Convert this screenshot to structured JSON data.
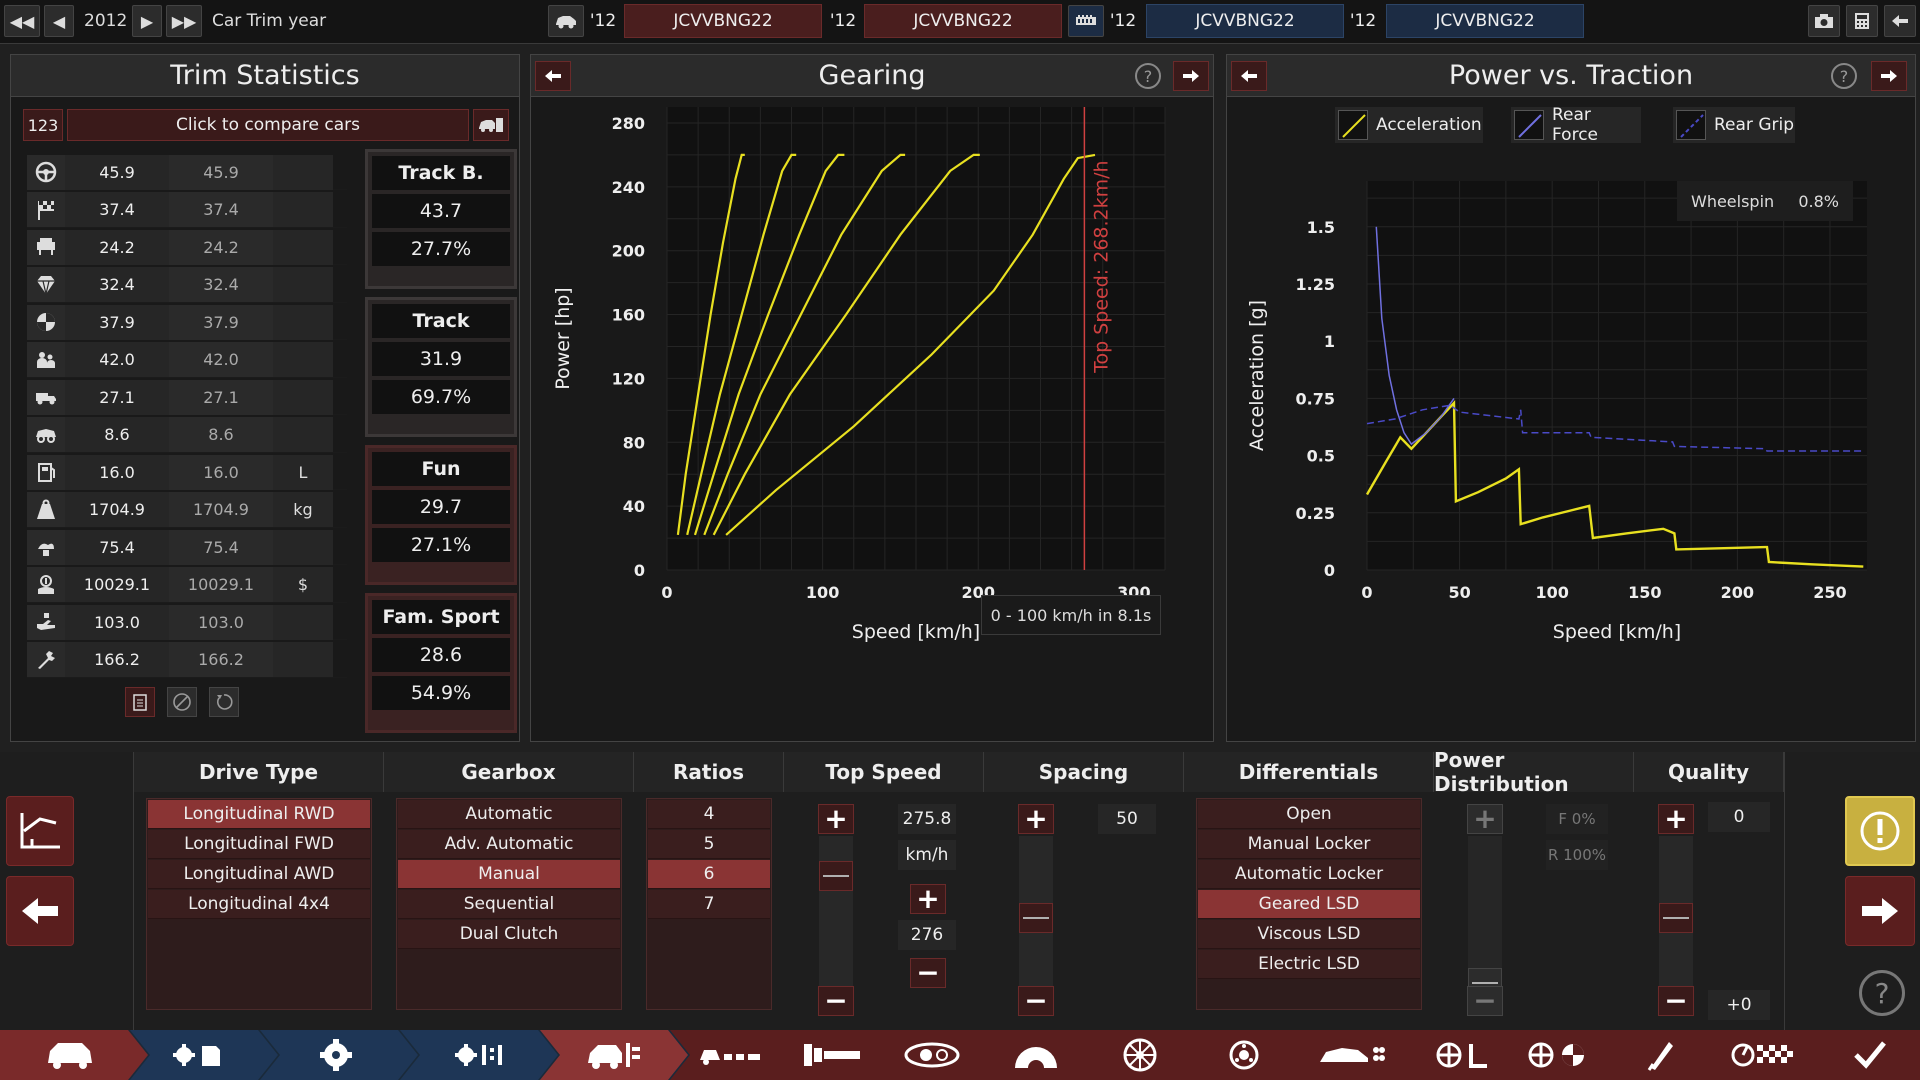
{
  "topbar": {
    "year": "2012",
    "title": "Car Trim year",
    "slots": [
      {
        "year": "'12",
        "name": "JCVVBNG22"
      },
      {
        "year": "'12",
        "name": "JCVVBNG22"
      },
      {
        "year": "'12",
        "name": "JCVVBNG22"
      },
      {
        "year": "'12",
        "name": "JCVVBNG22"
      }
    ]
  },
  "trim_stats": {
    "title": "Trim Statistics",
    "compare_count": "123",
    "compare_label": "Click to compare cars",
    "rows": [
      {
        "icon": "steering-wheel-icon",
        "value": "45.9",
        "compare": "45.9",
        "unit": ""
      },
      {
        "icon": "checkered-flag-icon",
        "value": "37.4",
        "compare": "37.4",
        "unit": ""
      },
      {
        "icon": "seat-icon",
        "value": "24.2",
        "compare": "24.2",
        "unit": ""
      },
      {
        "icon": "gem-icon",
        "value": "32.4",
        "compare": "32.4",
        "unit": ""
      },
      {
        "icon": "safety-icon",
        "value": "37.9",
        "compare": "37.9",
        "unit": ""
      },
      {
        "icon": "passengers-icon",
        "value": "42.0",
        "compare": "42.0",
        "unit": ""
      },
      {
        "icon": "utility-car-icon",
        "value": "27.1",
        "compare": "27.1",
        "unit": ""
      },
      {
        "icon": "offroad-car-icon",
        "value": "8.6",
        "compare": "8.6",
        "unit": ""
      },
      {
        "icon": "fuel-icon",
        "value": "16.0",
        "compare": "16.0",
        "unit": "L"
      },
      {
        "icon": "weight-icon",
        "value": "1704.9",
        "compare": "1704.9",
        "unit": "kg"
      },
      {
        "icon": "emissions-icon",
        "value": "75.4",
        "compare": "75.4",
        "unit": ""
      },
      {
        "icon": "cost-icon",
        "value": "10029.1",
        "compare": "10029.1",
        "unit": "$"
      },
      {
        "icon": "hands-icon",
        "value": "103.0",
        "compare": "103.0",
        "unit": ""
      },
      {
        "icon": "service-icon",
        "value": "166.2",
        "compare": "166.2",
        "unit": ""
      }
    ],
    "categories": [
      {
        "name": "Track B.",
        "score": "43.7",
        "pct": "27.7%"
      },
      {
        "name": "Track",
        "score": "31.9",
        "pct": "69.7%"
      },
      {
        "name": "Fun",
        "score": "29.7",
        "pct": "27.1%"
      },
      {
        "name": "Fam. Sport",
        "score": "28.6",
        "pct": "54.9%"
      }
    ]
  },
  "gearing": {
    "title": "Gearing",
    "acceleration_note": "0 - 100 km/h in 8.1s",
    "top_speed_label": "Top Speed: 268.2km/h"
  },
  "traction": {
    "title": "Power vs. Traction",
    "legend": [
      "Acceleration",
      "Rear Force",
      "Rear Grip"
    ],
    "wheelspin_label": "Wheelspin",
    "wheelspin_value": "0.8%"
  },
  "chart_data": [
    {
      "type": "line",
      "title": "Gearing",
      "xlabel": "Speed [km/h]",
      "ylabel": "Power [hp]",
      "xlim": [
        0,
        320
      ],
      "ylim": [
        0,
        290
      ],
      "xticks": [
        0,
        100,
        200,
        300
      ],
      "yticks": [
        0,
        40,
        80,
        120,
        160,
        200,
        240,
        280
      ],
      "grid": true,
      "top_speed": 268.2,
      "colors": {
        "gears": "#e8e020",
        "top_speed": "#d04040"
      },
      "series": [
        {
          "points": [
            [
              7,
              22
            ],
            [
              12,
              60
            ],
            [
              20,
              110
            ],
            [
              28,
              160
            ],
            [
              36,
              205
            ],
            [
              44,
              245
            ],
            [
              48,
              260
            ],
            [
              50,
              260
            ]
          ]
        },
        {
          "points": [
            [
              13,
              22
            ],
            [
              22,
              60
            ],
            [
              34,
              110
            ],
            [
              48,
              160
            ],
            [
              62,
              210
            ],
            [
              74,
              250
            ],
            [
              80,
              260
            ],
            [
              83,
              260
            ]
          ]
        },
        {
          "points": [
            [
              18,
              22
            ],
            [
              30,
              60
            ],
            [
              46,
              110
            ],
            [
              65,
              160
            ],
            [
              85,
              210
            ],
            [
              102,
              250
            ],
            [
              110,
              260
            ],
            [
              114,
              260
            ]
          ]
        },
        {
          "points": [
            [
              24,
              22
            ],
            [
              39,
              60
            ],
            [
              60,
              110
            ],
            [
              86,
              160
            ],
            [
              112,
              210
            ],
            [
              138,
              250
            ],
            [
              150,
              260
            ],
            [
              153,
              260
            ]
          ]
        },
        {
          "points": [
            [
              30,
              22
            ],
            [
              50,
              60
            ],
            [
              79,
              110
            ],
            [
              115,
              160
            ],
            [
              150,
              210
            ],
            [
              182,
              250
            ],
            [
              197,
              260
            ],
            [
              201,
              260
            ]
          ]
        },
        {
          "points": [
            [
              38,
              22
            ],
            [
              70,
              50
            ],
            [
              120,
              90
            ],
            [
              170,
              135
            ],
            [
              210,
              175
            ],
            [
              235,
              210
            ],
            [
              255,
              245
            ],
            [
              264,
              258
            ],
            [
              275,
              260
            ]
          ]
        }
      ]
    },
    {
      "type": "line",
      "title": "Power vs. Traction",
      "xlabel": "Speed [km/h]",
      "ylabel": "Acceleration [g]",
      "xlim": [
        0,
        270
      ],
      "ylim": [
        0,
        1.7
      ],
      "xticks": [
        0,
        50,
        100,
        150,
        200,
        250
      ],
      "yticks": [
        0,
        0.25,
        0.5,
        0.75,
        1,
        1.25,
        1.5
      ],
      "ytick_labels": [
        "0",
        "0.25",
        "0.5",
        "0.75",
        "1",
        "1.25",
        "1.5"
      ],
      "grid": true,
      "legend_position": "top",
      "series": [
        {
          "name": "Acceleration",
          "color": "#e8e020",
          "dash": false,
          "points": [
            [
              0,
              0.33
            ],
            [
              10,
              0.47
            ],
            [
              18,
              0.58
            ],
            [
              24,
              0.53
            ],
            [
              32,
              0.6
            ],
            [
              40,
              0.67
            ],
            [
              47,
              0.73
            ],
            [
              48,
              0.3
            ],
            [
              60,
              0.34
            ],
            [
              75,
              0.4
            ],
            [
              82,
              0.44
            ],
            [
              83,
              0.2
            ],
            [
              95,
              0.23
            ],
            [
              110,
              0.26
            ],
            [
              120,
              0.28
            ],
            [
              122,
              0.14
            ],
            [
              140,
              0.16
            ],
            [
              160,
              0.18
            ],
            [
              166,
              0.16
            ],
            [
              167,
              0.09
            ],
            [
              190,
              0.095
            ],
            [
              215,
              0.1
            ],
            [
              216,
              0.1
            ],
            [
              217,
              0.035
            ],
            [
              240,
              0.025
            ],
            [
              268,
              0.015
            ]
          ]
        },
        {
          "name": "Rear Force",
          "color": "#7070e0",
          "dash": false,
          "points": [
            [
              5,
              1.5
            ],
            [
              8,
              1.1
            ],
            [
              12,
              0.85
            ],
            [
              16,
              0.7
            ],
            [
              20,
              0.6
            ],
            [
              24,
              0.55
            ],
            [
              32,
              0.6
            ],
            [
              40,
              0.67
            ],
            [
              47,
              0.75
            ]
          ]
        },
        {
          "name": "Rear Grip",
          "color": "#4a4ac8",
          "dash": true,
          "points": [
            [
              0,
              0.64
            ],
            [
              15,
              0.66
            ],
            [
              30,
              0.7
            ],
            [
              45,
              0.72
            ],
            [
              50,
              0.69
            ],
            [
              82,
              0.66
            ],
            [
              83,
              0.7
            ],
            [
              84,
              0.6
            ],
            [
              110,
              0.6
            ],
            [
              120,
              0.6
            ],
            [
              121,
              0.58
            ],
            [
              165,
              0.56
            ],
            [
              166,
              0.54
            ],
            [
              215,
              0.53
            ],
            [
              216,
              0.52
            ],
            [
              268,
              0.52
            ]
          ]
        }
      ]
    }
  ],
  "bottom": {
    "drive_type": {
      "title": "Drive Type",
      "options": [
        "Longitudinal RWD",
        "Longitudinal FWD",
        "Longitudinal AWD",
        "Longitudinal 4x4"
      ],
      "selected": 0
    },
    "gearbox": {
      "title": "Gearbox",
      "options": [
        "Automatic",
        "Adv. Automatic",
        "Manual",
        "Sequential",
        "Dual Clutch"
      ],
      "selected": 2
    },
    "ratios": {
      "title": "Ratios",
      "options": [
        "4",
        "5",
        "6",
        "7"
      ],
      "selected": 2
    },
    "top_speed": {
      "title": "Top Speed",
      "value": "275.8",
      "unit": "km/h",
      "target": "276",
      "slider_level": 0.82
    },
    "spacing": {
      "title": "Spacing",
      "value": "50",
      "slider_level": 0.5
    },
    "differentials": {
      "title": "Differentials",
      "options": [
        "Open",
        "Manual Locker",
        "Automatic Locker",
        "Geared LSD",
        "Viscous LSD",
        "Electric LSD"
      ],
      "selected": 3
    },
    "power_distribution": {
      "title": "Power Distribution",
      "front": "F 0%",
      "rear": "R 100%",
      "slider_level": 0.0
    },
    "quality": {
      "title": "Quality",
      "value": "0",
      "delta": "+0",
      "slider_level": 0.5
    }
  },
  "colors": {
    "accent_red": "#8a3434",
    "chart_yellow": "#e8e020",
    "top_speed_line": "#d04040",
    "warning": "#c8b040"
  }
}
